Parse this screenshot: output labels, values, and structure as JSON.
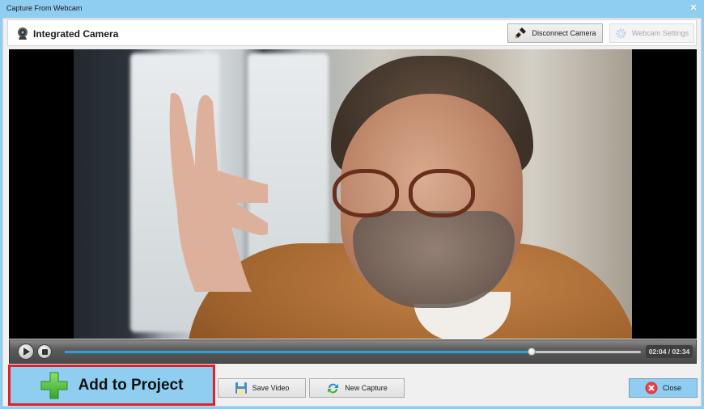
{
  "window": {
    "title": "Capture From Webcam",
    "close_icon": "close-x-icon"
  },
  "header": {
    "camera_icon": "webcam-icon",
    "camera_name": "Integrated Camera",
    "disconnect_label": "Disconnect Camera",
    "disconnect_icon": "plug-disconnect-icon",
    "settings_label": "Webcam Settings",
    "settings_icon": "gear-icon",
    "settings_enabled": false
  },
  "video": {
    "description": "Webcam preview: man with glasses and beard in brown sweater gesturing with hand"
  },
  "playback": {
    "play_icon": "play-icon",
    "stop_icon": "stop-icon",
    "progress_fraction": 0.81,
    "current_time": "02:04",
    "total_time": "02:34",
    "timecode": "02:04 / 02:34"
  },
  "actions": {
    "add_label": "Add to Project",
    "add_icon": "green-plus-icon",
    "add_highlight_color": "#e0202a",
    "save_label": "Save Video",
    "save_icon": "floppy-disk-icon",
    "new_label": "New Capture",
    "new_icon": "refresh-arrows-icon",
    "close_label": "Close",
    "close_icon": "red-x-circle-icon"
  },
  "colors": {
    "accent_blue": "#8fcdf1",
    "progress_blue": "#29a3e0"
  }
}
